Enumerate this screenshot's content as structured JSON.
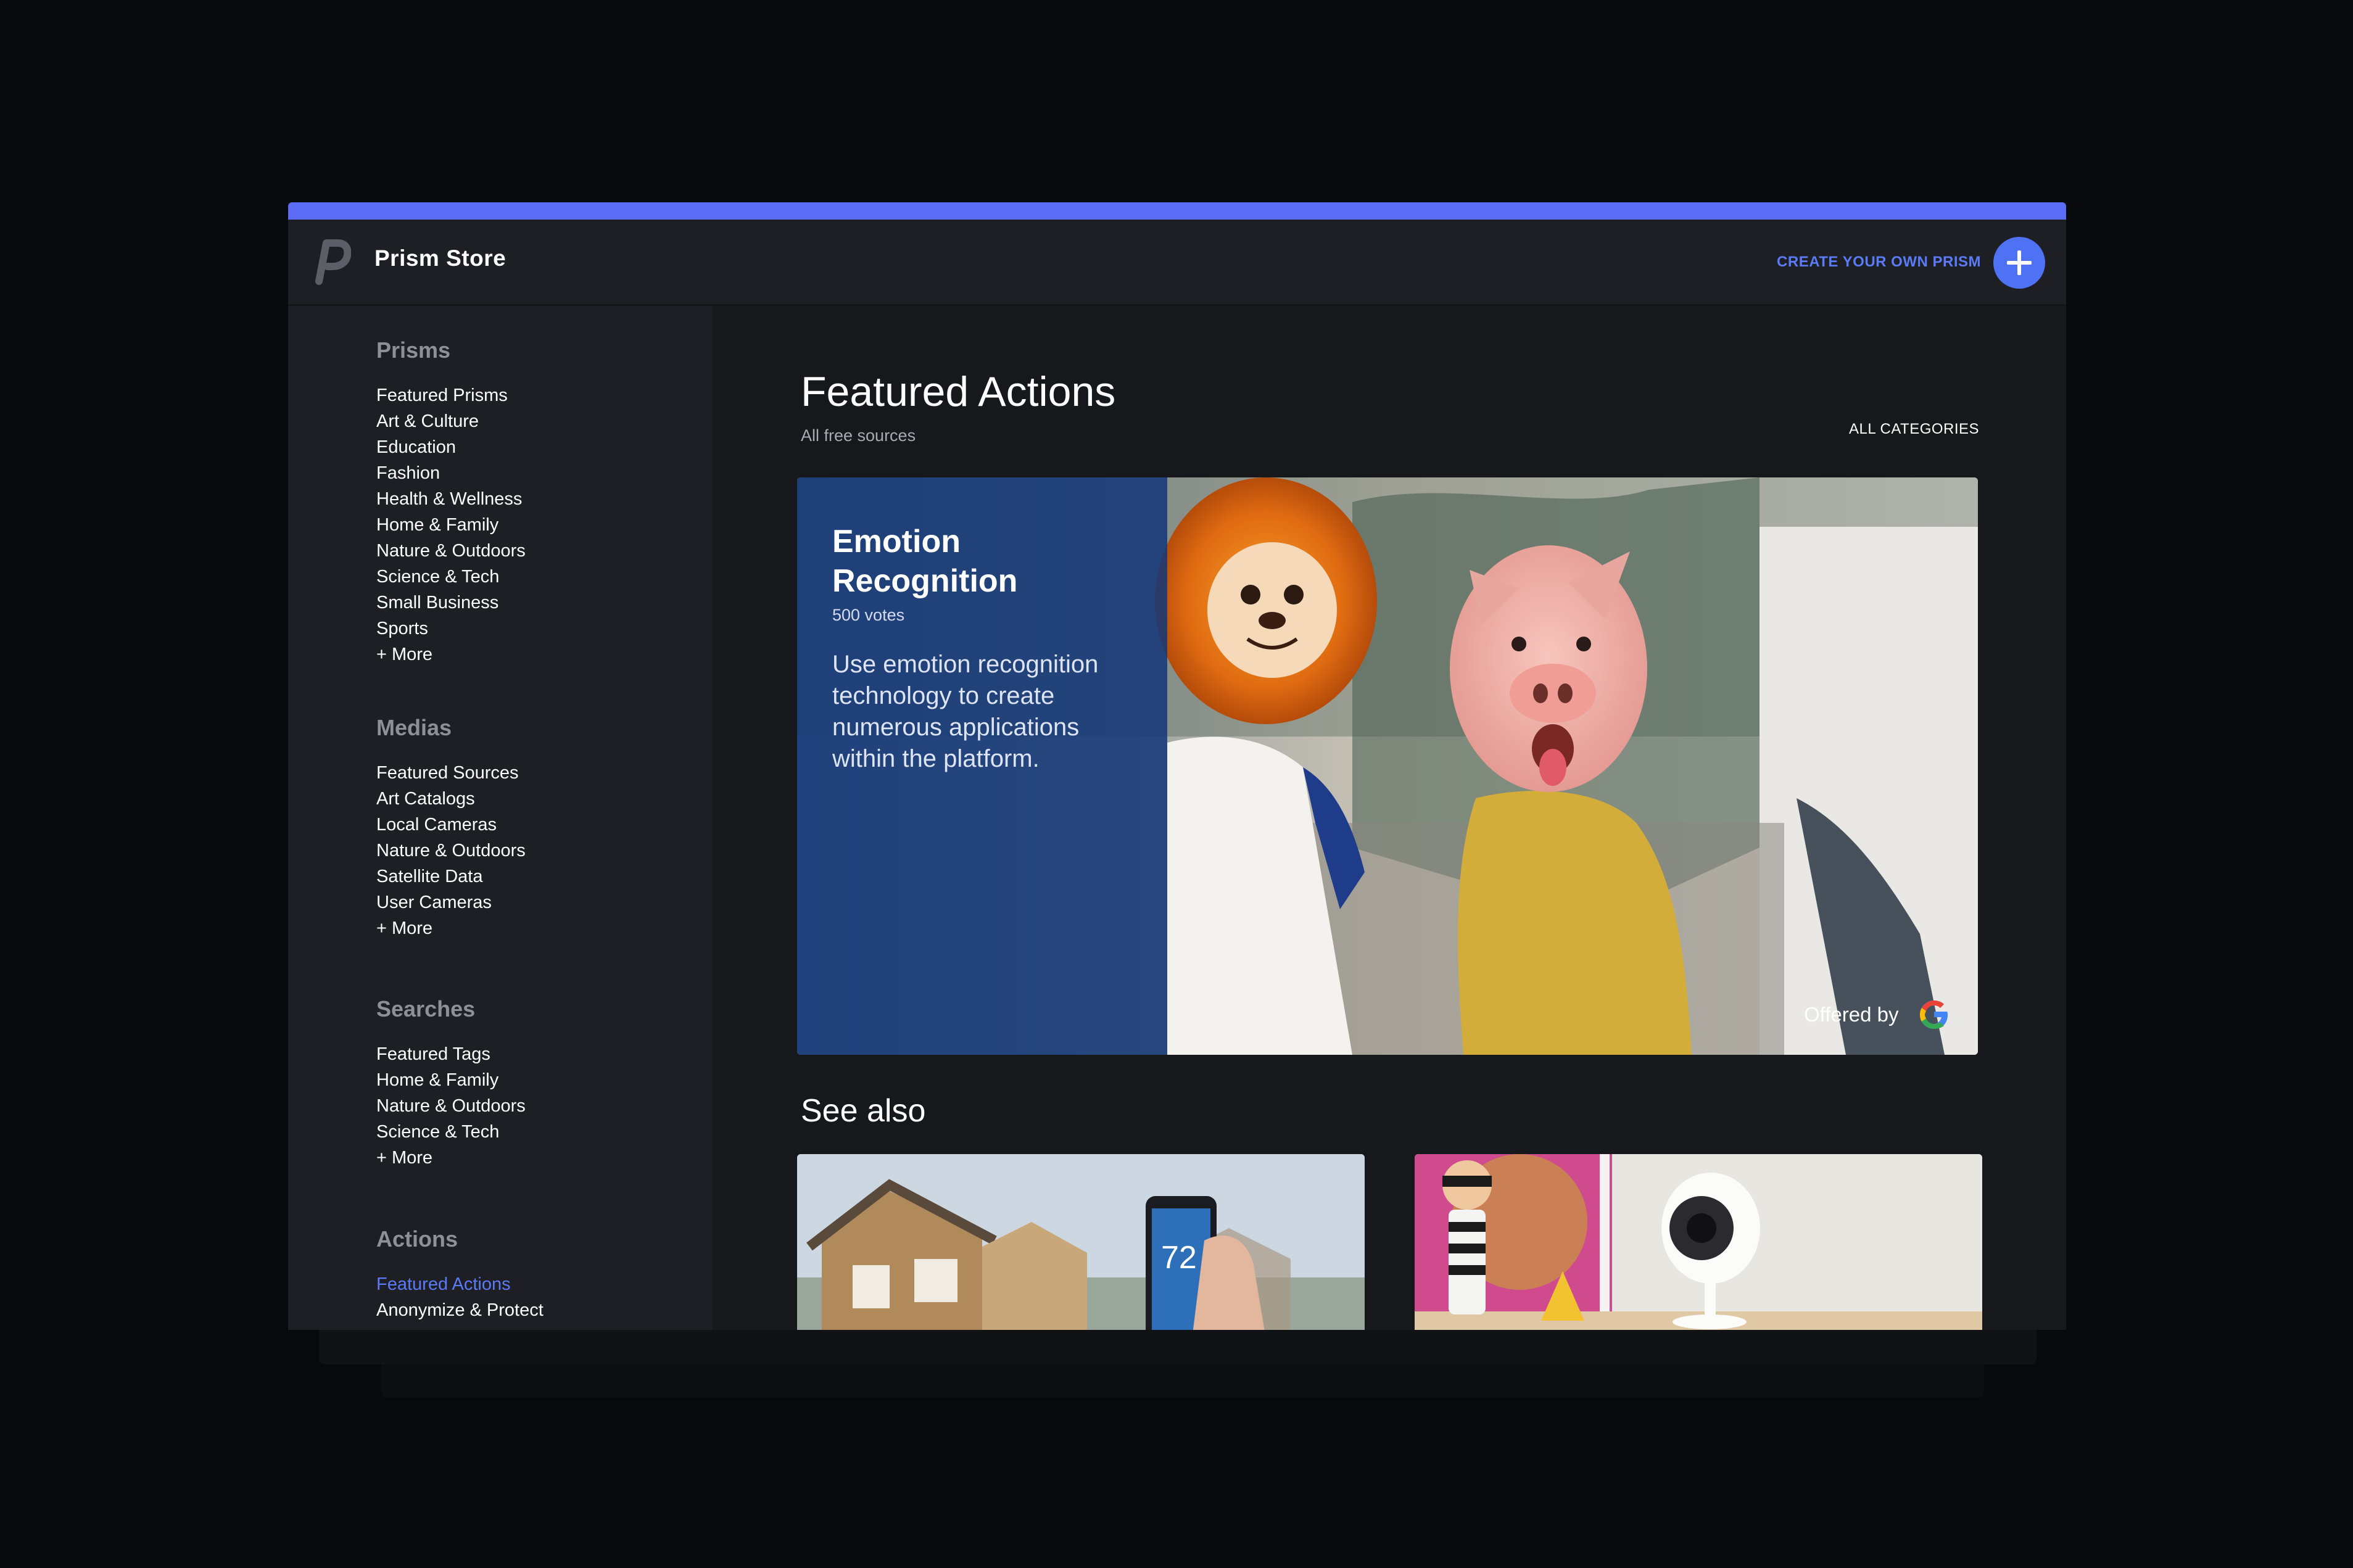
{
  "app": {
    "title": "Prism Store",
    "create_label": "CREATE YOUR OWN PRISM",
    "accent_color": "#5b6bf4",
    "link_color": "#5b7bf6"
  },
  "sidebar": {
    "sections": [
      {
        "heading": "Prisms",
        "items": [
          "Featured Prisms",
          "Art & Culture",
          "Education",
          "Fashion",
          "Health & Wellness",
          "Home & Family",
          "Nature & Outdoors",
          "Science & Tech",
          "Small Business",
          "Sports",
          "+ More"
        ]
      },
      {
        "heading": "Medias",
        "items": [
          "Featured Sources",
          "Art Catalogs",
          "Local Cameras",
          "Nature & Outdoors",
          "Satellite Data",
          "User Cameras",
          "+ More"
        ]
      },
      {
        "heading": "Searches",
        "items": [
          "Featured Tags",
          "Home & Family",
          "Nature & Outdoors",
          "Science & Tech",
          "+ More"
        ]
      },
      {
        "heading": "Actions",
        "items": [
          "Featured Actions",
          "Anonymize & Protect"
        ]
      }
    ],
    "active_item": "Featured Actions"
  },
  "main": {
    "title": "Featured Actions",
    "subtitle": "All free sources",
    "all_categories": "ALL CATEGORIES",
    "hero": {
      "title": "Emotion Recognition",
      "votes": "500 votes",
      "description": "Use emotion recognition technology to create numerous applications within the platform.",
      "offered_by": "Offered by"
    },
    "see_also": "See also",
    "phone_temp": "72"
  }
}
